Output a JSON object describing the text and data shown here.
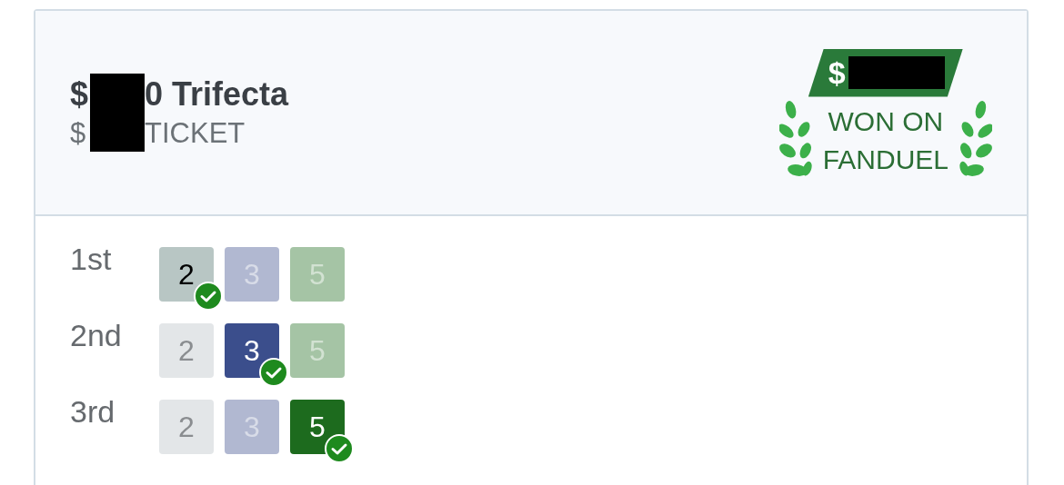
{
  "ticket": {
    "title_start": "$",
    "title_end": "0 Trifecta",
    "subtitle_start": "$",
    "subtitle_end": "TICKET",
    "redacted": true
  },
  "badge": {
    "amount_start": "$",
    "amount_redacted": true,
    "line_1": "WON ON",
    "line_2": "FANDUEL"
  },
  "legs": [
    {
      "label": "1st",
      "runners": [
        {
          "number": "2",
          "color": "#b8c6c4",
          "selected": true,
          "won": true
        },
        {
          "number": "3",
          "color": "#b1b8d1",
          "selected": false,
          "won": false
        },
        {
          "number": "5",
          "color": "#a5c4a5",
          "selected": false,
          "won": false
        }
      ]
    },
    {
      "label": "2nd",
      "runners": [
        {
          "number": "2",
          "color": "#e3e6e8",
          "selected": false,
          "won": false
        },
        {
          "number": "3",
          "color": "#3b4e8c",
          "selected": true,
          "won": true
        },
        {
          "number": "5",
          "color": "#a5c4a5",
          "selected": false,
          "won": false
        }
      ]
    },
    {
      "label": "3rd",
      "runners": [
        {
          "number": "2",
          "color": "#e3e6e8",
          "selected": false,
          "won": false
        },
        {
          "number": "3",
          "color": "#b1b8d1",
          "selected": false,
          "won": false
        },
        {
          "number": "5",
          "color": "#1d6b1e",
          "selected": true,
          "won": true
        }
      ]
    }
  ]
}
